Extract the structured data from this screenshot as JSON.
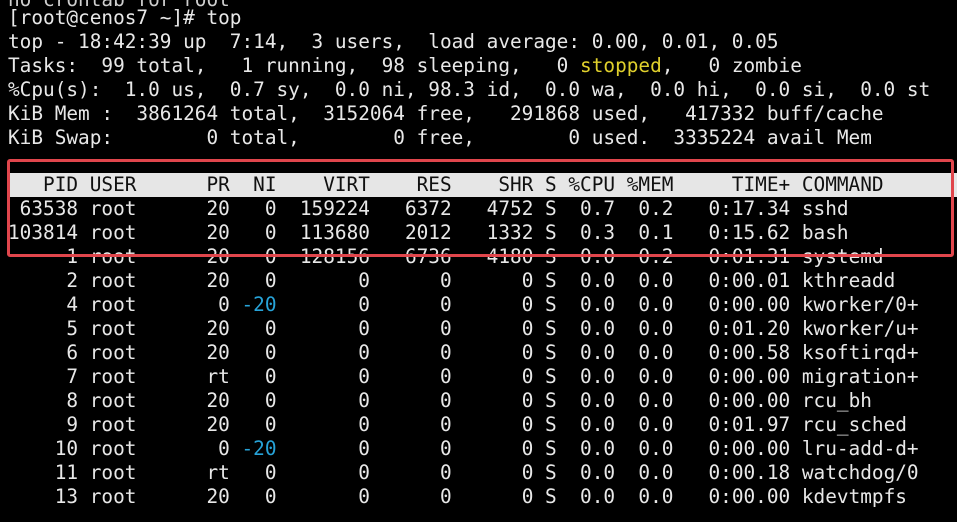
{
  "terminal": {
    "cutoff_line": "no crontab for root",
    "prompt": "[root@cenos7 ~]# top",
    "summary": {
      "uptime": "top - 18:42:39 up  7:14,  3 users,  load average: 0.00, 0.01, 0.05",
      "tasks_pre": "Tasks:  99 total,   1 running,  98 sleeping,   0 ",
      "tasks_stopped": "stopped",
      "tasks_post": ",   0 zombie",
      "cpu": "%Cpu(s):  1.0 us,  0.7 sy,  0.0 ni, 98.3 id,  0.0 wa,  0.0 hi,  0.0 si,  0.0 st",
      "mem": "KiB Mem :  3861264 total,  3152064 free,   291868 used,   417332 buff/cache",
      "swap": "KiB Swap:        0 total,        0 free,        0 used.  3335224 avail Mem"
    },
    "header": "   PID USER      PR  NI    VIRT    RES    SHR S %CPU %MEM     TIME+ COMMAND",
    "processes": [
      {
        "pre": " 63538 root      20   ",
        "ni": "0",
        "post": "  159224   6372   4752 S  0.7  0.2   0:17.34 sshd",
        "ni_neg": false
      },
      {
        "pre": "103814 root      20   ",
        "ni": "0",
        "post": "  113680   2012   1332 S  0.3  0.1   0:15.62 bash",
        "ni_neg": false
      },
      {
        "pre": "     1 root      20   ",
        "ni": "0",
        "post": "  128156   6736   4180 S  0.0  0.2   0:01.31 systemd",
        "ni_neg": false
      },
      {
        "pre": "     2 root      20   ",
        "ni": "0",
        "post": "       0      0      0 S  0.0  0.0   0:00.01 kthreadd",
        "ni_neg": false
      },
      {
        "pre": "     4 root       0 ",
        "ni": "-20",
        "post": "       0      0      0 S  0.0  0.0   0:00.00 kworker/0+",
        "ni_neg": true
      },
      {
        "pre": "     5 root      20   ",
        "ni": "0",
        "post": "       0      0      0 S  0.0  0.0   0:01.20 kworker/u+",
        "ni_neg": false
      },
      {
        "pre": "     6 root      20   ",
        "ni": "0",
        "post": "       0      0      0 S  0.0  0.0   0:00.58 ksoftirqd+",
        "ni_neg": false
      },
      {
        "pre": "     7 root      rt   ",
        "ni": "0",
        "post": "       0      0      0 S  0.0  0.0   0:00.00 migration+",
        "ni_neg": false
      },
      {
        "pre": "     8 root      20   ",
        "ni": "0",
        "post": "       0      0      0 S  0.0  0.0   0:00.00 rcu_bh",
        "ni_neg": false
      },
      {
        "pre": "     9 root      20   ",
        "ni": "0",
        "post": "       0      0      0 S  0.0  0.0   0:01.97 rcu_sched",
        "ni_neg": false
      },
      {
        "pre": "    10 root       0 ",
        "ni": "-20",
        "post": "       0      0      0 S  0.0  0.0   0:00.00 lru-add-d+",
        "ni_neg": true
      },
      {
        "pre": "    11 root      rt   ",
        "ni": "0",
        "post": "       0      0      0 S  0.0  0.0   0:00.18 watchdog/0",
        "ni_neg": false
      },
      {
        "pre": "    13 root      20   ",
        "ni": "0",
        "post": "       0      0      0 S  0.0  0.0   0:00.00 kdevtmpfs",
        "ni_neg": false
      }
    ]
  },
  "colors": {
    "background": "#000000",
    "text": "#e8e8e8",
    "stopped": "#e0d02c",
    "negative_nice": "#27a3d8",
    "highlight_box": "#e0464c",
    "header_bar": "#e6e6e6"
  }
}
